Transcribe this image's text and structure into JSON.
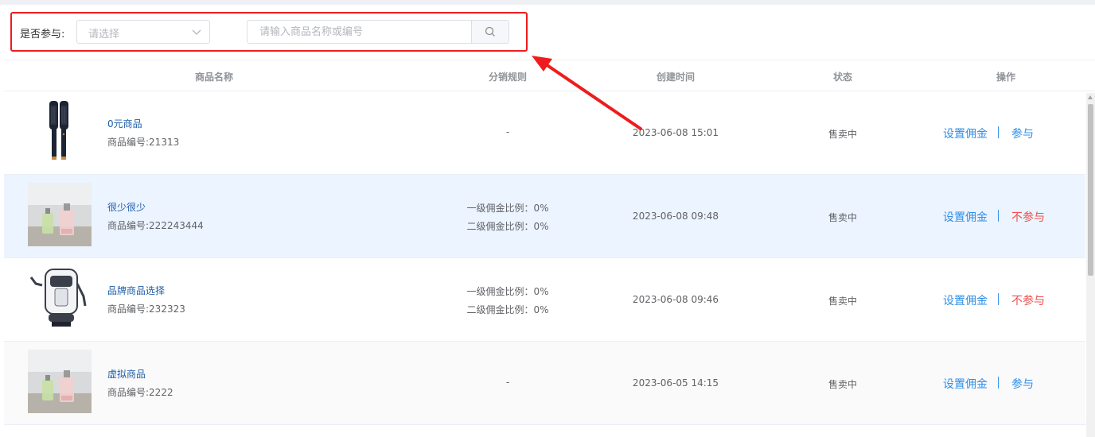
{
  "filters": {
    "participate_label": "是否参与:",
    "select_placeholder": "请选择",
    "search_placeholder": "请输入商品名称或编号"
  },
  "table": {
    "columns": [
      "商品名称",
      "分销规则",
      "创建时间",
      "状态",
      "操作"
    ],
    "rows": [
      {
        "name": "0元商品",
        "code": "商品编号:21313",
        "rule": "-",
        "rule1": "",
        "rule2": "",
        "created": "2023-06-08 15:01",
        "status": "售卖中",
        "action_set": "设置佣金",
        "action_toggle": "参与"
      },
      {
        "name": "很少很少",
        "code": "商品编号:222243444",
        "rule": "",
        "rule1": "一级佣金比例：0%",
        "rule2": "二级佣金比例：0%",
        "created": "2023-06-08 09:48",
        "status": "售卖中",
        "action_set": "设置佣金",
        "action_toggle": "不参与"
      },
      {
        "name": "品牌商品选择",
        "code": "商品编号:232323",
        "rule": "",
        "rule1": "一级佣金比例：0%",
        "rule2": "二级佣金比例：0%",
        "created": "2023-06-08 09:46",
        "status": "售卖中",
        "action_set": "设置佣金",
        "action_toggle": "不参与"
      },
      {
        "name": "虚拟商品",
        "code": "商品编号:2222",
        "rule": "-",
        "rule1": "",
        "rule2": "",
        "created": "2023-06-05 14:15",
        "status": "售卖中",
        "action_set": "设置佣金",
        "action_toggle": "参与"
      }
    ]
  },
  "colors": {
    "annotation": "#ee1c1c",
    "link": "#2f8ee8",
    "danger": "#f04f4f",
    "hover_row": "#ecf4ff"
  },
  "icons": {
    "select_chevron": "chevron-down-icon",
    "search_button": "search-icon"
  }
}
